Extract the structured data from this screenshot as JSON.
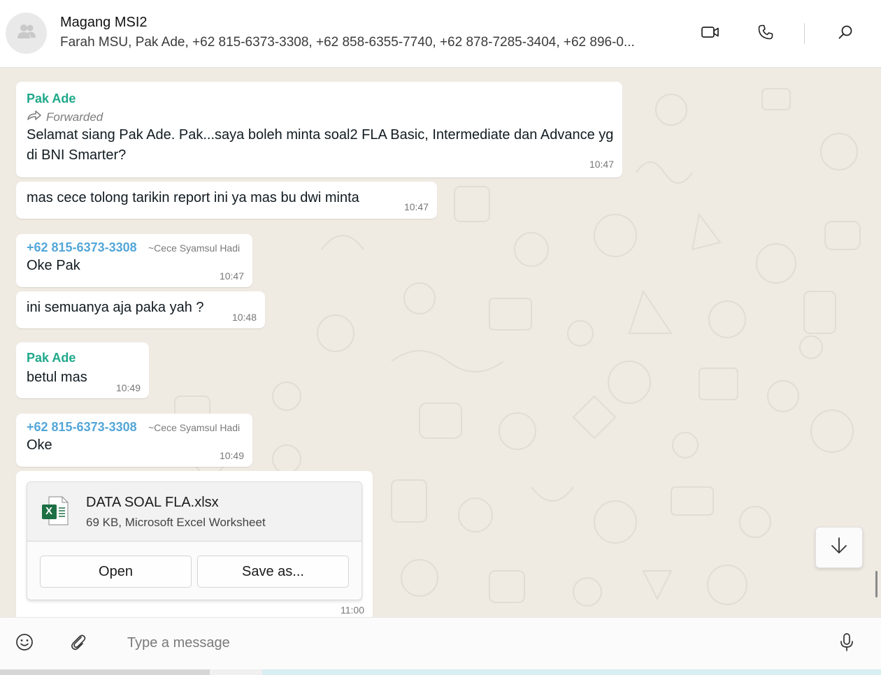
{
  "header": {
    "title": "Magang MSI2",
    "subtitle": "Farah MSU, Pak Ade, +62 815-6373-3308, +62 858-6355-7740, +62 878-7285-3404, +62 896-0...",
    "icons": [
      "group-avatar-icon",
      "video-call-icon",
      "voice-call-icon",
      "search-icon"
    ]
  },
  "messages": [
    {
      "sender": "Pak Ade",
      "forwarded_label": "Forwarded",
      "text": "Selamat siang Pak Ade. Pak...saya boleh minta soal2 FLA Basic, Intermediate dan Advance yg di BNI Smarter?",
      "time": "10:47"
    },
    {
      "text": "mas cece tolong tarikin report ini ya mas bu dwi minta",
      "time": "10:47"
    },
    {
      "sender": "+62 815-6373-3308",
      "alias": "~Cece Syamsul Hadi",
      "text": "Oke Pak",
      "time": "10:47"
    },
    {
      "text": "ini semuanya aja paka yah ?",
      "time": "10:48"
    },
    {
      "sender": "Pak Ade",
      "text": "betul mas",
      "time": "10:49"
    },
    {
      "sender": "+62 815-6373-3308",
      "alias": "~Cece Syamsul Hadi",
      "text": "Oke",
      "time": "10:49"
    }
  ],
  "file": {
    "name": "DATA SOAL FLA.xlsx",
    "meta": "69 KB, Microsoft Excel Worksheet",
    "icon_letter": "X",
    "open_label": "Open",
    "save_label": "Save as...",
    "time": "11:00"
  },
  "composer": {
    "placeholder": "Type a message"
  },
  "colors": {
    "sender_green": "#1fa88a",
    "sender_blue": "#53a6d8",
    "chat_background": "#efeae2",
    "excel_green": "#1d7044"
  }
}
